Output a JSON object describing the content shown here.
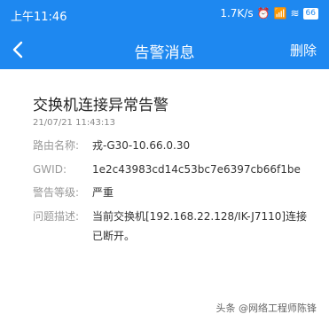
{
  "status_bar": {
    "time": "上午11:46",
    "speed": "1.7K/s",
    "battery": "66"
  },
  "header": {
    "title": "告警消息",
    "delete_label": "删除"
  },
  "alarm": {
    "title": "交换机连接异常告警",
    "timestamp": "21/07/21 11:43:13",
    "fields": [
      {
        "label": "路由名称:",
        "value": "戎-G30-10.66.0.30"
      },
      {
        "label": "GWID:",
        "value": "1e2c43983cd14c53bc7e6397cb66f1be"
      },
      {
        "label": "警告等级:",
        "value": "严重"
      },
      {
        "label": "问题描述:",
        "value_line1": "当前交换机[192.168.22.128/IK-J7110]连接",
        "value_line2": "已断开。"
      }
    ]
  },
  "watermark": "头条 @网络工程师陈锋",
  "colors": {
    "accent": "#1e88f0"
  }
}
